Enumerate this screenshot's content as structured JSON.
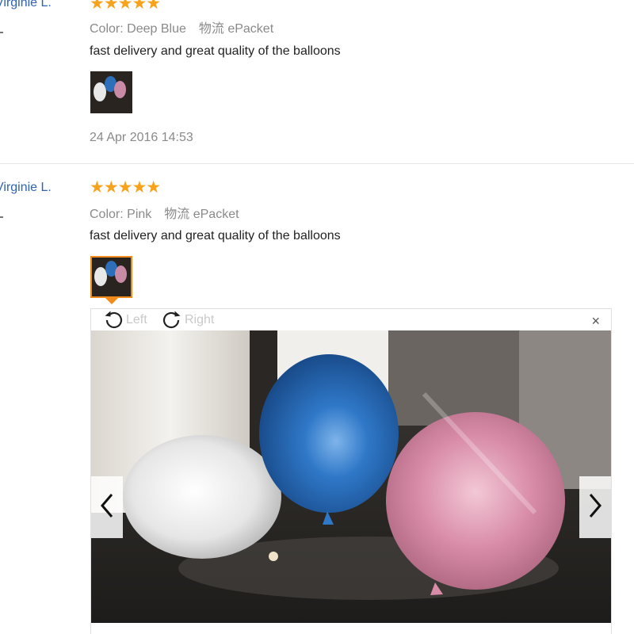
{
  "reviews": [
    {
      "user": "Virginie L.",
      "rating_stars": "★★★★★",
      "color_label": "Color:",
      "color_value": "Deep Blue",
      "shipping_label": "物流",
      "shipping_value": "ePacket",
      "feedback": "fast delivery and great quality of the balloons",
      "date": "24 Apr 2016 14:53"
    },
    {
      "user": "Virginie L.",
      "rating_stars": "★★★★★",
      "color_label": "Color:",
      "color_value": "Pink",
      "shipping_label": "物流",
      "shipping_value": "ePacket",
      "feedback": "fast delivery and great quality of the balloons"
    }
  ],
  "viewer": {
    "rotate_left_label": "Left",
    "rotate_right_label": "Right",
    "close_symbol": "×",
    "prev_icon": "chevron-left-icon",
    "next_icon": "chevron-right-icon"
  },
  "colors": {
    "star": "#f7a21b",
    "link": "#2f63b6",
    "active_thumb_border": "#f08b1c"
  }
}
